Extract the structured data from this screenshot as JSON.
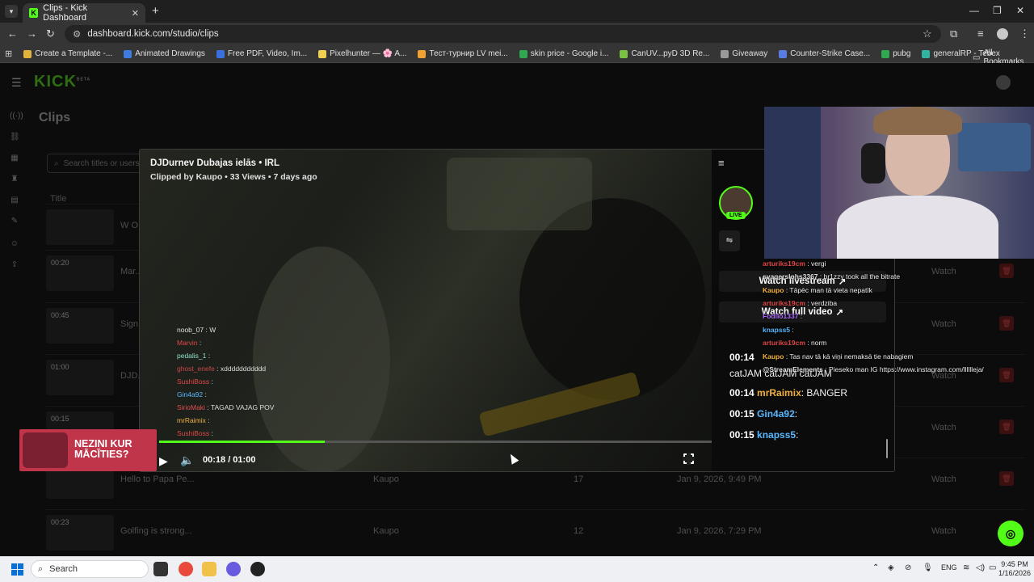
{
  "browser": {
    "tab_title": "Clips - Kick Dashboard",
    "tab_favicon": "K",
    "url": "dashboard.kick.com/studio/clips",
    "bookmarks": [
      {
        "label": "Create a Template -...",
        "color": "#e2b33a"
      },
      {
        "label": "Animated Drawings",
        "color": "#3d7de0"
      },
      {
        "label": "Free PDF, Video, Im...",
        "color": "#3a6fe0"
      },
      {
        "label": "Pixelhunter — 🌸 A...",
        "color": "#f0d050"
      },
      {
        "label": "Тест-турнир LV mei...",
        "color": "#f2a030"
      },
      {
        "label": "skin price - Google i...",
        "color": "#2fa84f"
      },
      {
        "label": "CanUV...pyD 3D Re...",
        "color": "#7ac043"
      },
      {
        "label": "Giveaway",
        "color": "#999999"
      },
      {
        "label": "Counter-Strike Case...",
        "color": "#5a7be0"
      },
      {
        "label": "pubg",
        "color": "#2fa84f"
      },
      {
        "label": "generalRP - Tebex",
        "color": "#2fb5a0"
      }
    ],
    "all_bookmarks": "All Bookmarks"
  },
  "page": {
    "logo": "KICK",
    "logo_sup": "BETA",
    "title": "Clips",
    "search_placeholder": "Search titles or users",
    "col_title": "Title",
    "rows": [
      {
        "duration": "",
        "title": "W O...",
        "author": "",
        "views": "",
        "date": "",
        "watch": ""
      },
      {
        "duration": "00:20",
        "title": "Mar...",
        "author": "",
        "views": "",
        "date": "",
        "watch": "Watch"
      },
      {
        "duration": "00:45",
        "title": "Sign...",
        "author": "",
        "views": "",
        "date": "",
        "watch": "Watch"
      },
      {
        "duration": "01:00",
        "title": "DJD...",
        "author": "",
        "views": "",
        "date": "",
        "watch": "Watch"
      },
      {
        "duration": "00:15",
        "title": "",
        "author": "",
        "views": "",
        "date": "",
        "watch": "Watch"
      },
      {
        "duration": "",
        "title": "Hello to Papa Pe...",
        "author": "Kaupo",
        "views": "17",
        "date": "Jan 9, 2026, 9:49 PM",
        "watch": "Watch"
      },
      {
        "duration": "00:23",
        "title": "Golfing is strong...",
        "author": "Kaupo",
        "views": "12",
        "date": "Jan 9, 2026, 7:29 PM",
        "watch": "Watch"
      }
    ]
  },
  "modal": {
    "title": "DJDurnev Dubajas ielās • IRL",
    "subtitle": "Clipped by Kaupo • 33 Views • 7 days ago",
    "progress": 0.3,
    "time": "00:18 / 01:00",
    "overlay_chat": [
      {
        "user": "noob_07",
        "msg": "W",
        "color": "#e0e0e0"
      },
      {
        "user": "Marvin",
        "msg": "",
        "color": "#e04848"
      },
      {
        "user": "pedalis_1",
        "msg": "",
        "color": "#8ee0c8"
      },
      {
        "user": "ghost_enefe",
        "msg": "xddddddddddd",
        "color": "#c84848"
      },
      {
        "user": "SushiBoss",
        "msg": "",
        "color": "#e04848"
      },
      {
        "user": "Gin4a92",
        "msg": "",
        "color": "#58b8ff"
      },
      {
        "user": "SirioMaki",
        "msg": "TAGAD VAJAG POV",
        "color": "#e05050"
      },
      {
        "user": "mrRaimix",
        "msg": "",
        "color": "#f0b040"
      },
      {
        "user": "SushiBoss",
        "msg": "",
        "color": "#e04848"
      }
    ],
    "side": {
      "live": "LIVE",
      "watch_livestream": "Watch livestream",
      "watch_full": "Watch full video",
      "messages": [
        {
          "time": "00:14",
          "user": "",
          "msg": "",
          "color": "#f0b040"
        },
        {
          "time": "",
          "user": "",
          "msg": "catJAM catJAM catJAM",
          "color": "#ffffff"
        },
        {
          "time": "00:14",
          "user": "mrRaimix",
          "msg": ": BANGER",
          "color": "#f0b040"
        },
        {
          "time": "00:15",
          "user": "Gin4a92",
          "msg": ":",
          "color": "#58b8ff"
        },
        {
          "time": "00:15",
          "user": "knapss5",
          "msg": ":",
          "color": "#58b8ff"
        }
      ]
    }
  },
  "stream_chat": [
    {
      "user": "arturiks19cm",
      "msg": ": vergi",
      "color": "#e04848"
    },
    {
      "user": "svagerslohs3367",
      "msg": ": br1zzy took all the bitrate",
      "color": "#e0e0e0"
    },
    {
      "user": "Kaupo",
      "msg": ": Tāpēc man tā vieta nepatīk",
      "color": "#f0b040"
    },
    {
      "user": "arturiks19cm",
      "msg": ": verdziba",
      "color": "#e04848"
    },
    {
      "user": "Fodilo1337",
      "msg": ":",
      "color": "#b070ff"
    },
    {
      "user": "knapss5",
      "msg": ":",
      "color": "#58b8ff"
    },
    {
      "user": "arturiks19cm",
      "msg": ": norm",
      "color": "#e04848"
    },
    {
      "user": "Kaupo",
      "msg": ": Tas nav tā kā viņi nemaksā tie nabagiem",
      "color": "#f0b040"
    },
    {
      "user": "@StreamElements",
      "msg": ": Pieseko man IG https://www.instagram.com/lllllleja/",
      "color": "#e0e0e0"
    }
  ],
  "ad": {
    "text_line1": "NEZINI KUR",
    "text_line2": "MĀCĪTIES?"
  },
  "taskbar": {
    "search": "Search",
    "lang": "ENG",
    "time": "9:45 PM",
    "date": "1/16/2026"
  },
  "colors": {
    "kick_green": "#53fc18",
    "delete_red": "#3a1010"
  }
}
